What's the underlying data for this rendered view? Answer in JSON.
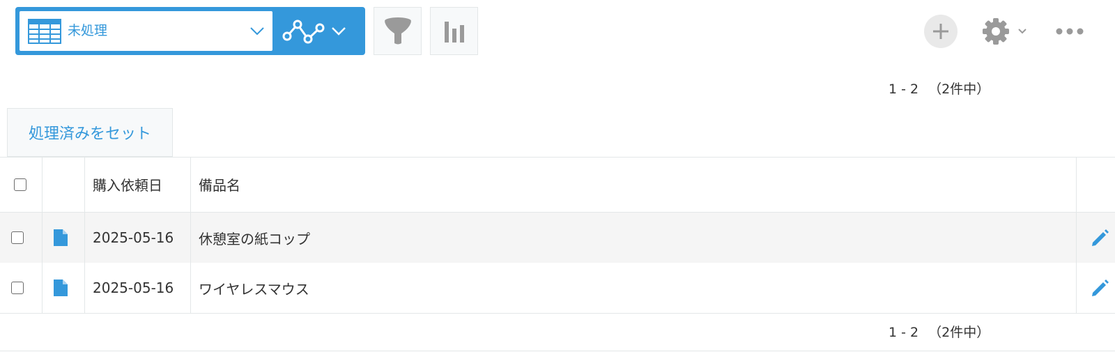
{
  "toolbar": {
    "view_name": "未処理",
    "icons": {
      "view_list": "table-icon",
      "view_dropdown": "chevron-down-icon",
      "graph": "line-graph-icon",
      "graph_dropdown": "chevron-down-icon",
      "filter": "funnel-icon",
      "chart": "bar-chart-icon",
      "add": "plus-icon",
      "settings": "gear-icon",
      "more": "more-horizontal-icon"
    },
    "accent_color": "#3498db"
  },
  "pagination": {
    "range": "1 - 2",
    "total": "（2件中）"
  },
  "action_button_label": "処理済みをセット",
  "table": {
    "columns": [
      "購入依頼日",
      "備品名"
    ],
    "rows": [
      {
        "date": "2025-05-16",
        "item": "休憩室の紙コップ"
      },
      {
        "date": "2025-05-16",
        "item": "ワイヤレスマウス"
      }
    ],
    "row_icons": {
      "detail": "document-icon",
      "edit": "pencil-icon"
    }
  }
}
